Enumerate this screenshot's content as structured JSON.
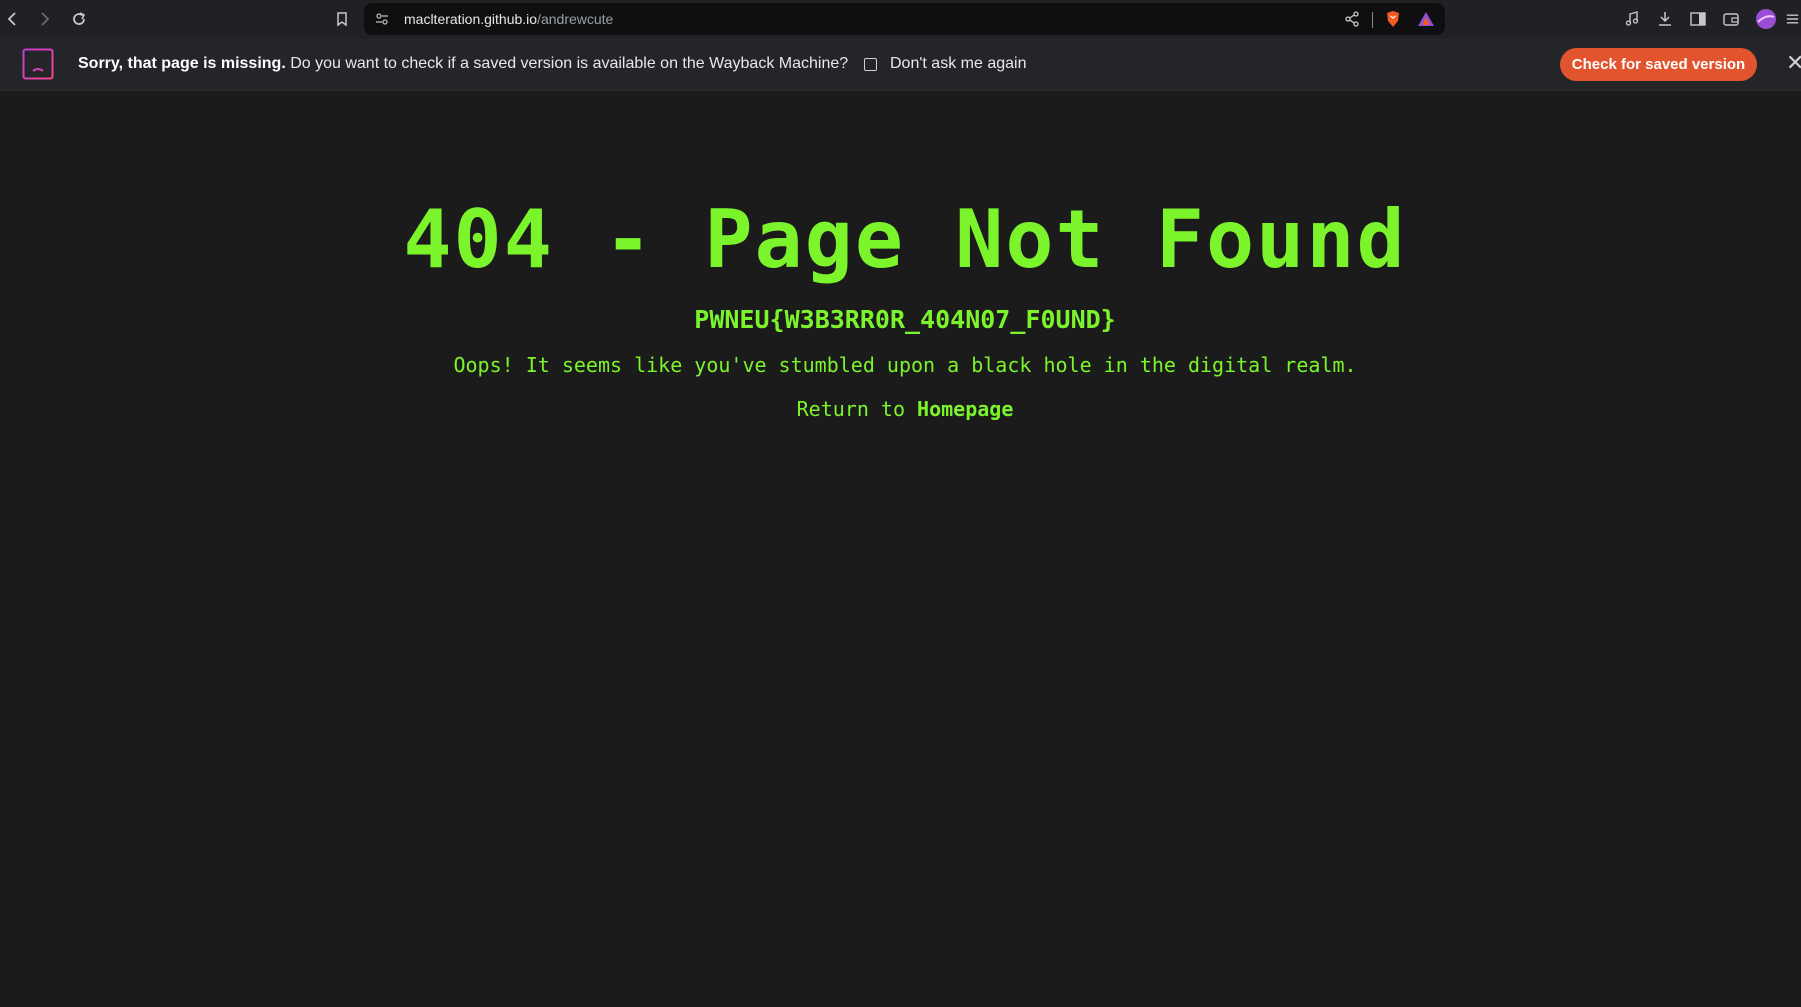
{
  "browser": {
    "url_host": "maclteration.github.io",
    "url_path": "/andrewcute",
    "icons": [
      "back-icon",
      "forward-icon",
      "reload-icon",
      "bookmark-icon",
      "site-info-icon",
      "share-icon",
      "brave-shields-icon",
      "brave-rewards-icon",
      "media-icon",
      "download-icon",
      "sidebar-icon",
      "wallet-icon",
      "profile-avatar",
      "menu-icon"
    ]
  },
  "infobar": {
    "bold_text": "Sorry, that page is missing.",
    "text": " Do you want to check if a saved version is available on the Wayback Machine?",
    "checkbox_label": "Don't ask me again",
    "button_label": "Check for saved version",
    "close_label": "✕"
  },
  "page": {
    "title": "404 - Page Not Found",
    "flag": "PWNEU{W3B3RR0R_404N07_F0UND}",
    "message": "Oops! It seems like you've stumbled upon a black hole in the digital realm.",
    "return_prefix": "Return to ",
    "return_link": "Homepage",
    "accent_color": "#7cf42c",
    "background_color": "#1b1b1b"
  }
}
